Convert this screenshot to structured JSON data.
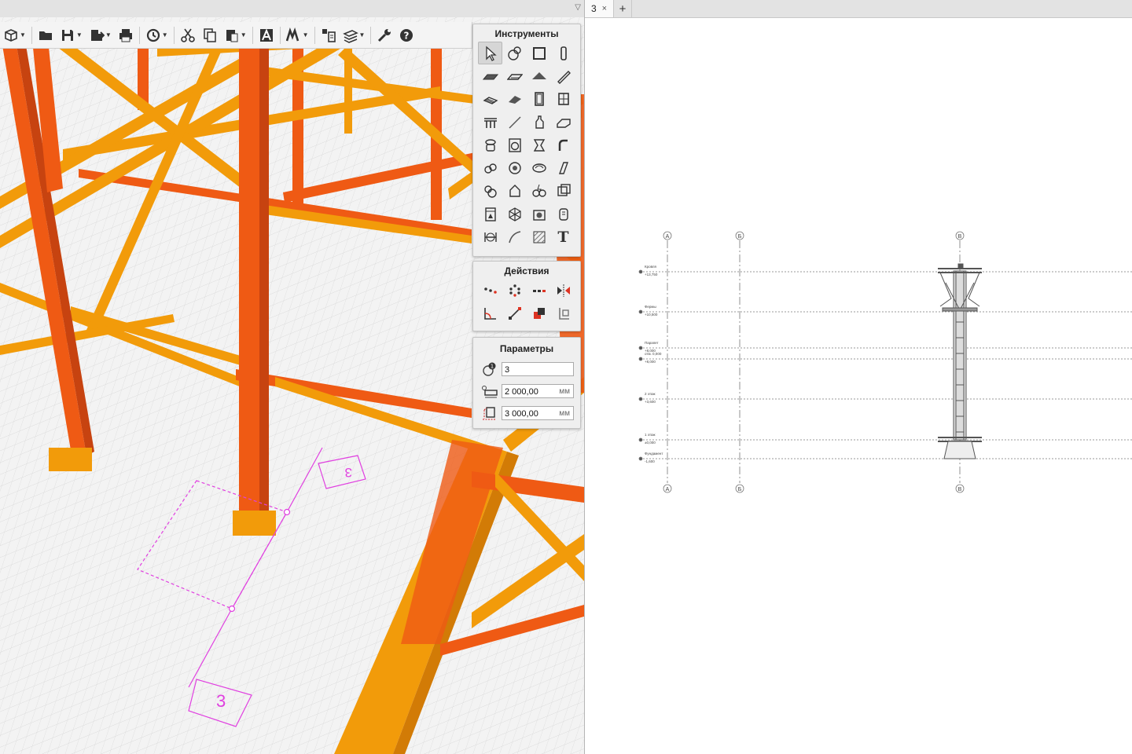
{
  "left_view": {
    "section_marker_top": "3",
    "section_marker_bottom": "3"
  },
  "right_tabs": {
    "active_tab_label": "3",
    "close_glyph": "×",
    "add_glyph": "+"
  },
  "pane_menu_glyph": "▽",
  "toolbar": {
    "buttons": [
      "view-3d-icon",
      "open-folder-icon",
      "save-icon",
      "export-icon",
      "print-icon",
      "sync-icon",
      "cut-icon",
      "copy-icon",
      "paste-icon",
      "text-style-icon",
      "render-icon",
      "layout-icon",
      "views-icon",
      "settings-icon",
      "help-icon"
    ]
  },
  "tools_panel": {
    "title": "Инструменты",
    "tools": [
      "select-icon",
      "stamp-icon",
      "rectangle-icon",
      "column-icon",
      "slab-icon",
      "plate-icon",
      "roof-icon",
      "beam-icon",
      "stair-icon",
      "ramp-icon",
      "door-icon",
      "window-icon",
      "railing-icon",
      "line-icon",
      "figure-icon",
      "duct-icon",
      "plumbing-icon",
      "washer-icon",
      "fitting-icon",
      "pipe-icon",
      "valve-icon",
      "pump-icon",
      "coil-icon",
      "shaft-icon",
      "assembly-icon",
      "lamp-icon",
      "electric-icon",
      "socket-icon",
      "panel-icon",
      "polyhedron-icon",
      "camera-icon",
      "device-icon",
      "dimension-icon",
      "curve-icon",
      "hatch-icon",
      "text-icon"
    ],
    "text_tool_glyph": "T"
  },
  "actions_panel": {
    "title": "Действия",
    "actions": [
      "array-line-icon",
      "array-circle-icon",
      "array-dots-icon",
      "mirror-icon",
      "angle-icon",
      "move-diagonal-icon",
      "copy-block-icon",
      "attach-icon"
    ]
  },
  "params_panel": {
    "title": "Параметры",
    "rows": [
      {
        "icon": "count-icon",
        "value": "3",
        "unit": ""
      },
      {
        "icon": "distance-icon",
        "value": "2 000,00",
        "unit": "мм"
      },
      {
        "icon": "height-icon",
        "value": "3 000,00",
        "unit": "мм"
      }
    ]
  },
  "elevation_drawing": {
    "axes": [
      "А",
      "Б",
      "В"
    ],
    "levels": [
      {
        "name": "Кровля",
        "mark": "+13,750"
      },
      {
        "name": "Фермы",
        "mark": "+10,500"
      },
      {
        "name": "Парапет",
        "mark": "+8,000"
      },
      {
        "name": "отм. 0,000",
        "mark": "+8,000"
      },
      {
        "name": "2 этаж",
        "mark": "+3,600"
      },
      {
        "name": "1 этаж",
        "mark": "±0,000"
      },
      {
        "name": "Фундамент",
        "mark": "-1,600"
      }
    ]
  },
  "colors": {
    "steel_orange": "#f29b0a",
    "steel_red": "#ef5a14",
    "section_line": "#e040e0"
  }
}
